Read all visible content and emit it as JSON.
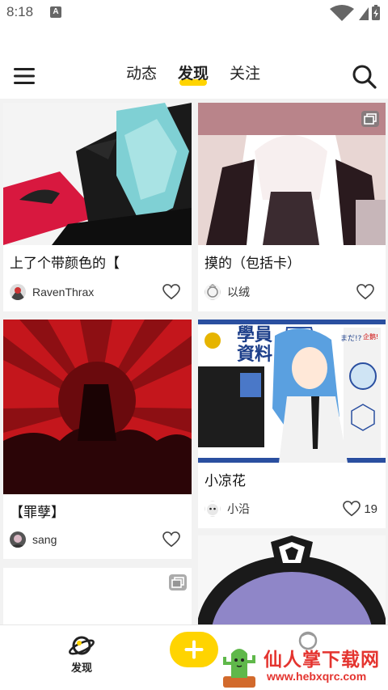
{
  "status_bar": {
    "time": "8:18",
    "notification_badge": "A"
  },
  "header": {
    "tabs": [
      {
        "label": "动态",
        "active": false
      },
      {
        "label": "发现",
        "active": true
      },
      {
        "label": "关注",
        "active": false
      }
    ],
    "accent_color": "#ffd400"
  },
  "feed": {
    "cards": [
      {
        "title": "上了个带颜色的【",
        "user": "RavenThrax",
        "likes": "",
        "multi_image": false
      },
      {
        "title": "摸的（包括卡）",
        "user": "以绒",
        "likes": "",
        "multi_image": true
      },
      {
        "title": "【罪孽】",
        "user": "sang",
        "likes": "",
        "multi_image": false
      },
      {
        "title": "小凉花",
        "user": "小沿",
        "likes": "19",
        "multi_image": false
      },
      {
        "title": "",
        "user": "",
        "likes": "",
        "multi_image": true
      },
      {
        "title": "",
        "user": "",
        "likes": "",
        "multi_image": false
      }
    ],
    "image_texts": {
      "card4_heading": "學員資料",
      "card4_bubble": "まだ!?",
      "card4_badge": "企鹅!"
    }
  },
  "bottom_nav": {
    "discover_label": "发现",
    "post_button_icon": "plus-icon"
  },
  "watermark": {
    "title": "仙人掌下载网",
    "url": "www.hebxqrc.com"
  }
}
